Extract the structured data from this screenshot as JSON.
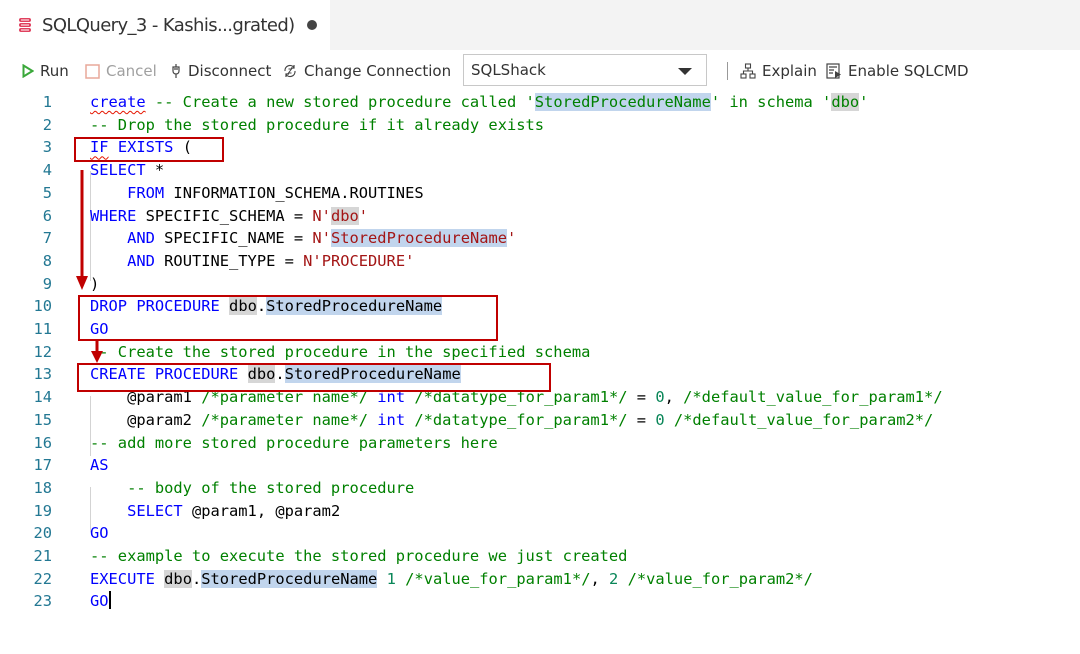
{
  "tab": {
    "icon": "database-icon",
    "title": "SQLQuery_3 - Kashis...grated)",
    "unsaved_indicator": "dirty-dot",
    "icon_color": "#e0405e"
  },
  "toolbar": {
    "run_label": "Run",
    "cancel_label": "Cancel",
    "disconnect_label": "Disconnect",
    "change_connection_label": "Change Connection",
    "database_selected": "SQLShack",
    "explain_label": "Explain",
    "enable_sqlcmd_label": "Enable SQLCMD"
  },
  "editor": {
    "lines": [
      {
        "n": "1",
        "tokens": [
          [
            "create",
            "kw squiggle"
          ],
          [
            " -- Create a new stored procedure called '",
            "cm"
          ],
          [
            "StoredProcedureName",
            "cm hl"
          ],
          [
            "' in schema '",
            "cm"
          ],
          [
            "dbo",
            "cm hl2"
          ],
          [
            "'",
            "cm"
          ]
        ]
      },
      {
        "n": "2",
        "tokens": [
          [
            "-- Drop the stored procedure if it already exists",
            "cm"
          ]
        ]
      },
      {
        "n": "3",
        "tokens": [
          [
            "IF",
            "kw squiggle"
          ],
          [
            " ",
            "id"
          ],
          [
            "EXISTS",
            "kw"
          ],
          [
            " (",
            "id"
          ]
        ]
      },
      {
        "n": "4",
        "tokens": [
          [
            "SELECT",
            "kw"
          ],
          [
            " *",
            "id"
          ]
        ]
      },
      {
        "n": "5",
        "tokens": [
          [
            "    ",
            "id"
          ],
          [
            "FROM",
            "kw"
          ],
          [
            " INFORMATION_SCHEMA.ROUTINES",
            "id"
          ]
        ]
      },
      {
        "n": "6",
        "tokens": [
          [
            "WHERE",
            "kw"
          ],
          [
            " SPECIFIC_SCHEMA = ",
            "id"
          ],
          [
            "N'",
            "str"
          ],
          [
            "dbo",
            "str hl2"
          ],
          [
            "'",
            "str"
          ]
        ]
      },
      {
        "n": "7",
        "tokens": [
          [
            "    ",
            "id"
          ],
          [
            "AND",
            "kw"
          ],
          [
            " SPECIFIC_NAME = ",
            "id"
          ],
          [
            "N'",
            "str"
          ],
          [
            "StoredProcedureName",
            "str hl"
          ],
          [
            "'",
            "str"
          ]
        ]
      },
      {
        "n": "8",
        "tokens": [
          [
            "    ",
            "id"
          ],
          [
            "AND",
            "kw"
          ],
          [
            " ROUTINE_TYPE = ",
            "id"
          ],
          [
            "N'PROCEDURE'",
            "str"
          ]
        ]
      },
      {
        "n": "9",
        "tokens": [
          [
            ")",
            "id"
          ]
        ]
      },
      {
        "n": "10",
        "tokens": [
          [
            "DROP",
            "kw"
          ],
          [
            " ",
            "id"
          ],
          [
            "PROCEDURE",
            "kw"
          ],
          [
            " ",
            "id"
          ],
          [
            "dbo",
            "id hl2"
          ],
          [
            ".",
            "id"
          ],
          [
            "StoredProcedureName",
            "id hl"
          ]
        ]
      },
      {
        "n": "11",
        "tokens": [
          [
            "GO",
            "kw"
          ]
        ]
      },
      {
        "n": "12",
        "tokens": [
          [
            "-- Create the stored procedure in the specified schema",
            "cm"
          ]
        ]
      },
      {
        "n": "13",
        "tokens": [
          [
            "CREATE",
            "kw"
          ],
          [
            " ",
            "id"
          ],
          [
            "PROCEDURE",
            "kw"
          ],
          [
            " ",
            "id"
          ],
          [
            "dbo",
            "id hl2"
          ],
          [
            ".",
            "id"
          ],
          [
            "StoredProcedureName",
            "id hl"
          ]
        ]
      },
      {
        "n": "14",
        "tokens": [
          [
            "    @param1 ",
            "id"
          ],
          [
            "/*parameter name*/",
            "cm"
          ],
          [
            " ",
            "id"
          ],
          [
            "int",
            "kw"
          ],
          [
            " ",
            "id"
          ],
          [
            "/*datatype_for_param1*/",
            "cm"
          ],
          [
            " = ",
            "id"
          ],
          [
            "0",
            "num"
          ],
          [
            ", ",
            "id"
          ],
          [
            "/*default_value_for_param1*/",
            "cm"
          ]
        ]
      },
      {
        "n": "15",
        "tokens": [
          [
            "    @param2 ",
            "id"
          ],
          [
            "/*parameter name*/",
            "cm"
          ],
          [
            " ",
            "id"
          ],
          [
            "int",
            "kw"
          ],
          [
            " ",
            "id"
          ],
          [
            "/*datatype_for_param1*/",
            "cm"
          ],
          [
            " = ",
            "id"
          ],
          [
            "0",
            "num"
          ],
          [
            " ",
            "id"
          ],
          [
            "/*default_value_for_param2*/",
            "cm"
          ]
        ]
      },
      {
        "n": "16",
        "tokens": [
          [
            "-- add more stored procedure parameters here",
            "cm"
          ]
        ]
      },
      {
        "n": "17",
        "tokens": [
          [
            "AS",
            "kw"
          ]
        ]
      },
      {
        "n": "18",
        "tokens": [
          [
            "    ",
            "id"
          ],
          [
            "-- body of the stored procedure",
            "cm"
          ]
        ]
      },
      {
        "n": "19",
        "tokens": [
          [
            "    ",
            "id"
          ],
          [
            "SELECT",
            "kw"
          ],
          [
            " @param1, @param2",
            "id"
          ]
        ]
      },
      {
        "n": "20",
        "tokens": [
          [
            "GO",
            "kw"
          ]
        ]
      },
      {
        "n": "21",
        "tokens": [
          [
            "-- example to execute the stored procedure we just created",
            "cm"
          ]
        ]
      },
      {
        "n": "22",
        "tokens": [
          [
            "EXECUTE",
            "kw"
          ],
          [
            " ",
            "id"
          ],
          [
            "dbo",
            "id hl2"
          ],
          [
            ".",
            "id"
          ],
          [
            "StoredProcedureName",
            "id hl"
          ],
          [
            " ",
            "id"
          ],
          [
            "1",
            "num"
          ],
          [
            " ",
            "id"
          ],
          [
            "/*value_for_param1*/",
            "cm"
          ],
          [
            ", ",
            "id"
          ],
          [
            "2",
            "num"
          ],
          [
            " ",
            "id"
          ],
          [
            "/*value_for_param2*/",
            "cm"
          ]
        ]
      },
      {
        "n": "23",
        "tokens": [
          [
            "GO",
            "kw"
          ]
        ],
        "cursor": true
      }
    ]
  },
  "annotations": {
    "color": "#c00000",
    "boxes": [
      "if-exists-box",
      "drop-procedure-box",
      "create-procedure-box"
    ],
    "arrows": [
      "arrow-if-exists-to-paren",
      "arrow-drop-to-create"
    ]
  }
}
